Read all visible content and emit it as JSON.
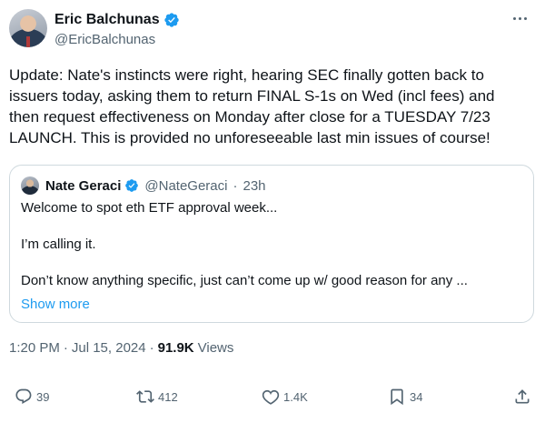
{
  "author": {
    "name": "Eric Balchunas",
    "handle": "@EricBalchunas",
    "verified": true
  },
  "tweet": {
    "text": "Update: Nate's instincts were right, hearing SEC finally gotten back to\nissuers today, asking them to return FINAL S-1s on Wed (incl fees) and\nthen request effectiveness on Monday after close for a TUESDAY 7/23\nLAUNCH. This is provided no unforeseeable last min issues of course!"
  },
  "quoted": {
    "name": "Nate Geraci",
    "handle": "@NateGeraci",
    "separator": "·",
    "age": "23h",
    "paragraphs": [
      "Welcome to spot eth ETF approval week...",
      "I’m calling it.",
      "Don’t know anything specific, just can’t come up w/ good reason for any ..."
    ],
    "show_more": "Show more"
  },
  "meta": {
    "time": "1:20 PM",
    "separator": "·",
    "date": "Jul 15, 2024",
    "views_count": "91.9K",
    "views_label": "Views"
  },
  "actions": {
    "replies": "39",
    "retweets": "412",
    "likes": "1.4K",
    "bookmarks": "34"
  },
  "colors": {
    "accent": "#1d9bf0",
    "text": "#0f1419",
    "muted": "#536471",
    "border": "#cfd9de"
  },
  "icons": [
    "more-icon",
    "verified-badge-icon",
    "reply-icon",
    "retweet-icon",
    "like-icon",
    "bookmark-icon",
    "share-icon"
  ]
}
